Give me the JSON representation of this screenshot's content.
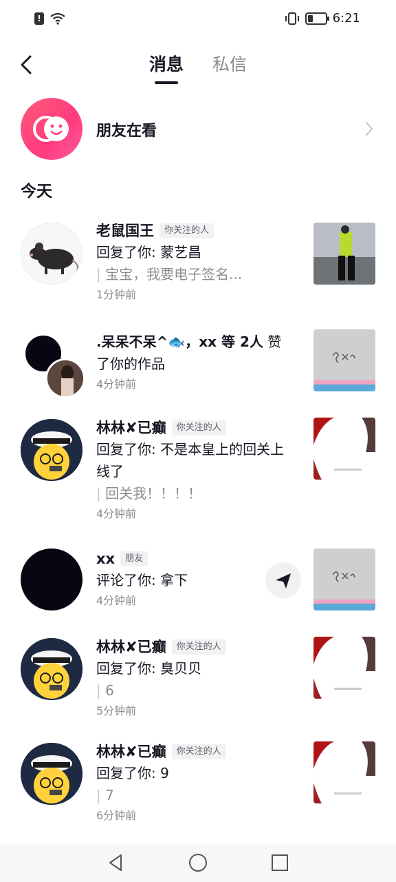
{
  "status_bar": {
    "time": "6:21",
    "battery_level": 0.3
  },
  "header": {
    "tabs": [
      {
        "label": "消息",
        "active": true
      },
      {
        "label": "私信",
        "active": false
      }
    ]
  },
  "friends_watching": {
    "label": "朋友在看"
  },
  "section": {
    "title": "今天"
  },
  "notifications": [
    {
      "name": "老鼠国王",
      "tag": "你关注的人",
      "action": "回复了你: 蒙艺昌",
      "quote": "宝宝，我要电子签名...",
      "time": "1分钟前"
    },
    {
      "name": ".呆呆不呆^🐟，xx 等 2人",
      "action_inline": "赞",
      "action": "了你的作品",
      "time": "4分钟前"
    },
    {
      "name": "林林✘已癫",
      "tag": "你关注的人",
      "action": "回复了你: 不是本皇上的回关上线了",
      "quote": "回关我！！！！",
      "time": "4分钟前"
    },
    {
      "name": "xx",
      "tag": "朋友",
      "action": "评论了你: 拿下",
      "time": "4分钟前"
    },
    {
      "name": "林林✘已癫",
      "tag": "你关注的人",
      "action": "回复了你: 臭贝贝",
      "quote": "6",
      "time": "5分钟前"
    },
    {
      "name": "林林✘已癫",
      "tag": "你关注的人",
      "action": "回复了你: 9",
      "quote": "7",
      "time": "6分钟前"
    }
  ],
  "colors": {
    "accent": "#fe2c55",
    "text_primary": "#161823",
    "text_secondary": "#8a8b91"
  }
}
